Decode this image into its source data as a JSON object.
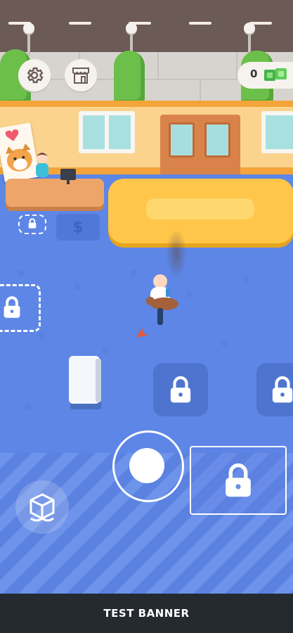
{
  "hud": {
    "settings_icon": "gear-icon",
    "shop_icon": "shop-icon",
    "money_value": "0",
    "money_icon": "cash-icon"
  },
  "floor": {
    "dollar_symbol": "$",
    "lock_icon": "lock-icon"
  },
  "controls": {
    "joystick": "joystick",
    "box_icon": "package-icon"
  },
  "banner": {
    "text": "TEST BANNER"
  },
  "colors": {
    "floor": "#5d86e6",
    "wall": "#fbd38c",
    "mat": "#ffc64a",
    "banner": "#252a31"
  }
}
